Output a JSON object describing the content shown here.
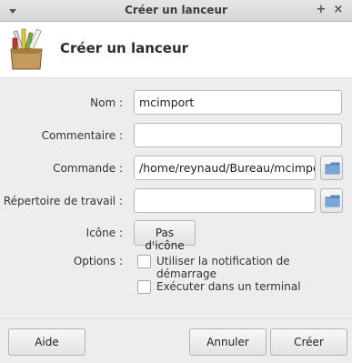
{
  "window": {
    "title": "Créer un lanceur",
    "menu_icon": "chevron-down-icon",
    "controls": {
      "pin": "+",
      "close": "×"
    }
  },
  "header": {
    "icon": "launcher-box-icon",
    "heading": "Créer un lanceur"
  },
  "form": {
    "name_label": "Nom :",
    "name_value": "mcimport",
    "comment_label": "Commentaire :",
    "comment_value": "",
    "command_label": "Commande :",
    "command_value": "/home/reynaud/Bureau/mcimport-",
    "workdir_label": "Répertoire de travail :",
    "workdir_value": "",
    "icon_label": "Icône :",
    "icon_button": "Pas d'icône",
    "options_label": "Options :",
    "option_startup_notify": "Utiliser la notification de démarrage",
    "option_terminal": "Exécuter dans un terminal",
    "startup_notify_checked": false,
    "terminal_checked": false
  },
  "buttons": {
    "help": "Aide",
    "cancel": "Annuler",
    "create": "Créer"
  },
  "colors": {
    "folder_icon": "#5b8fc7"
  }
}
